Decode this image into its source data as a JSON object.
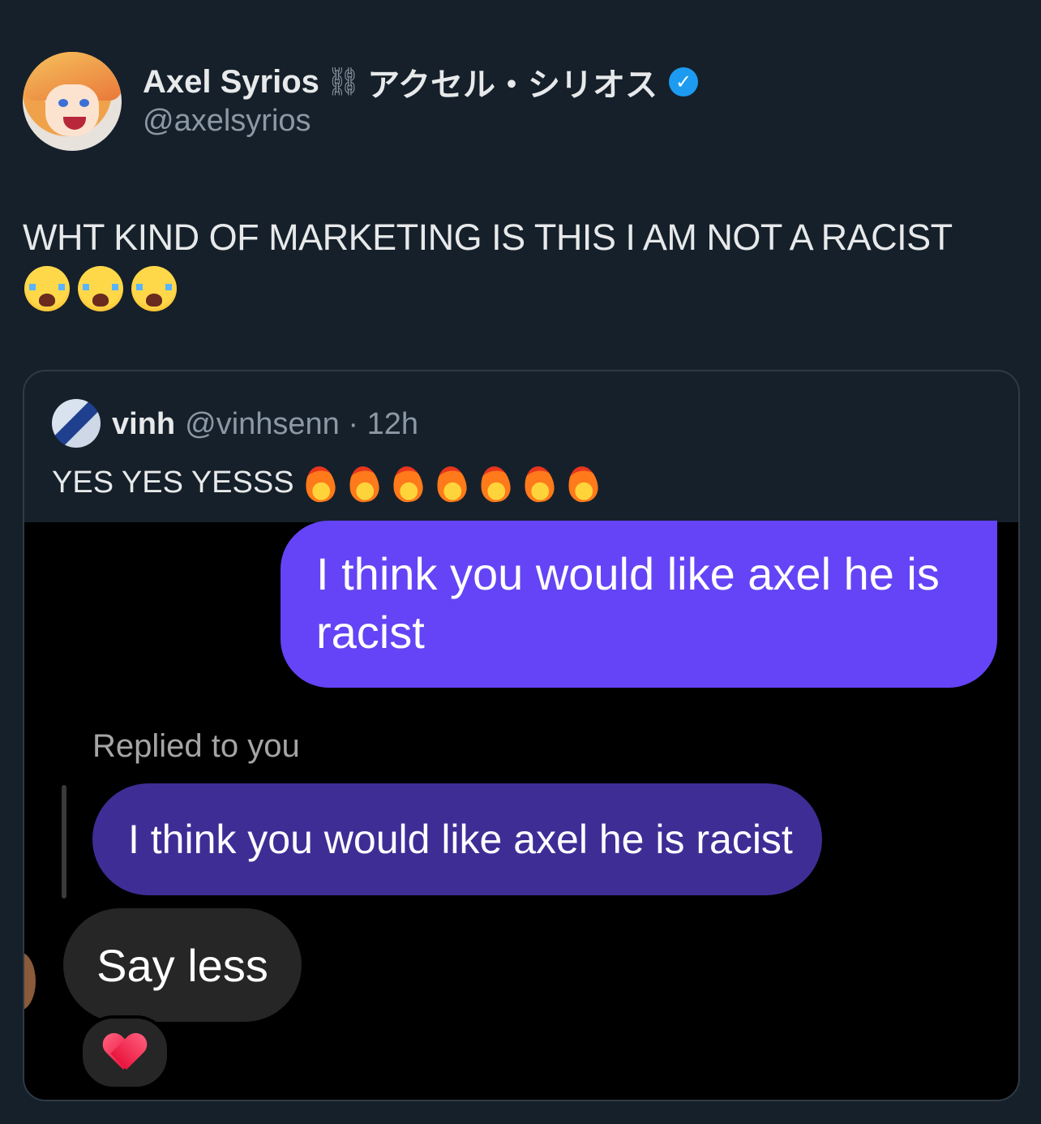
{
  "author": {
    "name": "Axel Syrios",
    "name_chain_glyph": "⛓",
    "name_japanese": "アクセル・シリオス",
    "verified_glyph": "✓",
    "handle": "@axelsyrios"
  },
  "tweet": {
    "text": "WHT KIND OF MARKETING IS THIS I AM NOT A RACIST",
    "emoji_count": 3,
    "emoji": "loudly-crying-face"
  },
  "quote": {
    "name": "vinh",
    "meta": "@vinhsenn · 12h",
    "text": "YES YES YESSS",
    "emoji_count": 7,
    "emoji": "fire",
    "media": {
      "sent_message": "I think you would like axel he is racist",
      "replied_label": "Replied to you",
      "quoted_message": "I think you would like axel he is racist",
      "received_message": "Say less",
      "reaction": "red-heart"
    }
  },
  "colors": {
    "background": "#16202a",
    "verified": "#1d9bf0",
    "sent_bubble": "#6444f6",
    "quoted_bubble": "#3f2d96",
    "received_bubble": "#262626"
  }
}
